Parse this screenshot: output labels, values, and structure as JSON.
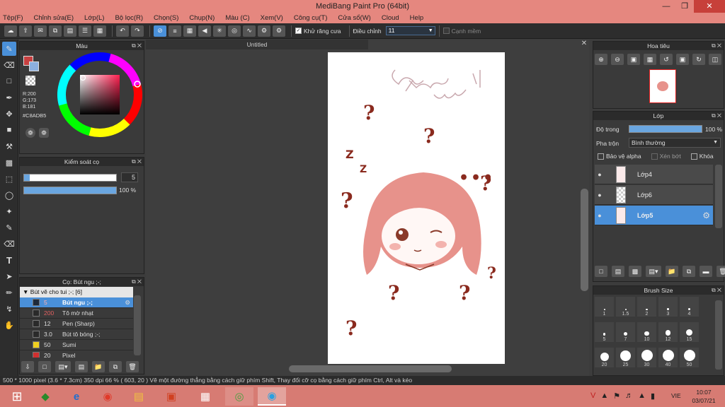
{
  "window": {
    "title": "MediBang Paint Pro (64bit)"
  },
  "menu": [
    "Tệp(F)",
    "Chỉnh sửa(E)",
    "Lớp(L)",
    "Bộ lọc(R)",
    "Chọn(S)",
    "Chụp(N)",
    "Màu (C)",
    "Xem(V)",
    "Công cụ(T)",
    "Cửa sổ(W)",
    "Cloud",
    "Help"
  ],
  "toolbar": {
    "antialias_label": "Khử răng cưa",
    "correction_label": "Điều chỉnh",
    "correction_value": "11",
    "snap_label": "Cạnh mềm"
  },
  "color_panel": {
    "title": "Màu",
    "r": "R:200",
    "g": "G:173",
    "b": "B:181",
    "hex": "#C8ADB5"
  },
  "brush_control": {
    "title": "Kiểm soát cọ",
    "size": "5",
    "opacity": "100 %"
  },
  "brush_panel": {
    "title": "Cọ: Bút ngu ;-;",
    "group": "Bút vẽ cho tui ;-; [6]",
    "items": [
      {
        "size": "5",
        "name": "Bút ngu ;-;",
        "color": "#1e2a3a"
      },
      {
        "size": "200",
        "name": "Tô mờ nhạt",
        "color": "#2a2a2a"
      },
      {
        "size": "12",
        "name": "Pen (Sharp)",
        "color": "#2a2a2a"
      },
      {
        "size": "3.0",
        "name": "Bút tô bóng ;-;",
        "color": "#2a2a2a"
      },
      {
        "size": "50",
        "name": "Sumi",
        "color": "#f0d020"
      },
      {
        "size": "20",
        "name": "Pixel",
        "color": "#d03030"
      }
    ]
  },
  "document": {
    "tab": "Untitled"
  },
  "navigator": {
    "title": "Hoa tiêu"
  },
  "layer_panel": {
    "title": "Lớp",
    "opacity_label": "Độ trong",
    "opacity_value": "100 %",
    "blend_label": "Pha trộn",
    "blend_value": "Bình thường",
    "protect_alpha": "Bảo vệ alpha",
    "clipping": "Xén bớt",
    "lock": "Khóa",
    "layers": [
      "Lớp4",
      "Lớp6",
      "Lớp5"
    ]
  },
  "brush_size_panel": {
    "title": "Brush Size",
    "sizes": [
      "1",
      "1.5",
      "2",
      "3",
      "4",
      "5",
      "7",
      "10",
      "12",
      "15",
      "20",
      "25",
      "30",
      "40",
      "50"
    ]
  },
  "status": {
    "text": "500 * 1000 pixel   (3.6 * 7.3cm)   350 dpi   66 %   ( 603, 20 )   Vẽ một đường thẳng bằng cách giữ phím Shift, Thay đổi cỡ cọ bằng cách giữ phím Ctrl, Alt và kéo"
  },
  "taskbar": {
    "lang": "VIE",
    "time": "10:07",
    "date": "03/07/21"
  },
  "colors": {
    "accent": "#4a90d9",
    "titlebar": "#e5877f",
    "sketch": "#9c3b2a",
    "hair": "#e8908a"
  }
}
